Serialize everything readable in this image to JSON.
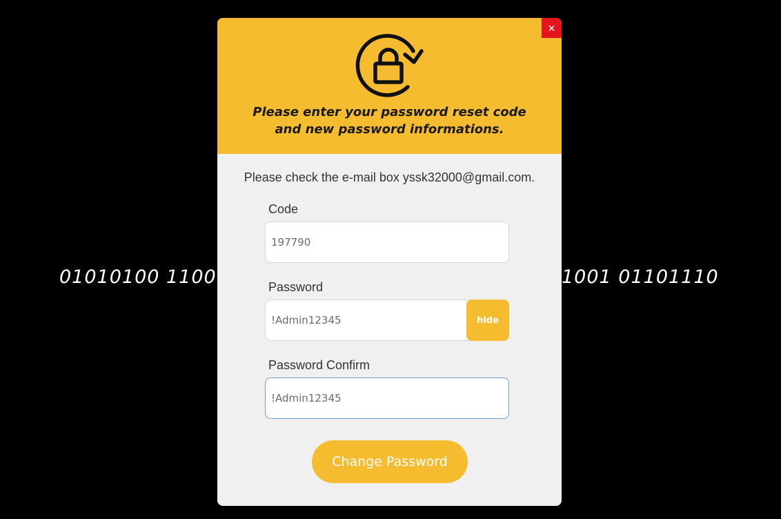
{
  "background": {
    "binary_left": "01010100 1100",
    "binary_right": "1001 01101110"
  },
  "modal": {
    "close_label": "✕",
    "header_text": "Please enter your password reset code and new password informations.",
    "check_text": "Please check the e-mail box yssk32000@gmail.com.",
    "fields": {
      "code": {
        "label": "Code",
        "value": "197790"
      },
      "password": {
        "label": "Password",
        "value": "!Admin12345",
        "toggle_label": "hide"
      },
      "password_confirm": {
        "label": "Password Confirm",
        "value": "!Admin12345"
      }
    },
    "submit_label": "Change Password"
  },
  "colors": {
    "accent": "#f5bc2f",
    "close": "#e8141c",
    "focus_border": "#6f9fd8"
  },
  "icons": {
    "header": "lock-reset-icon",
    "close": "close-icon"
  }
}
